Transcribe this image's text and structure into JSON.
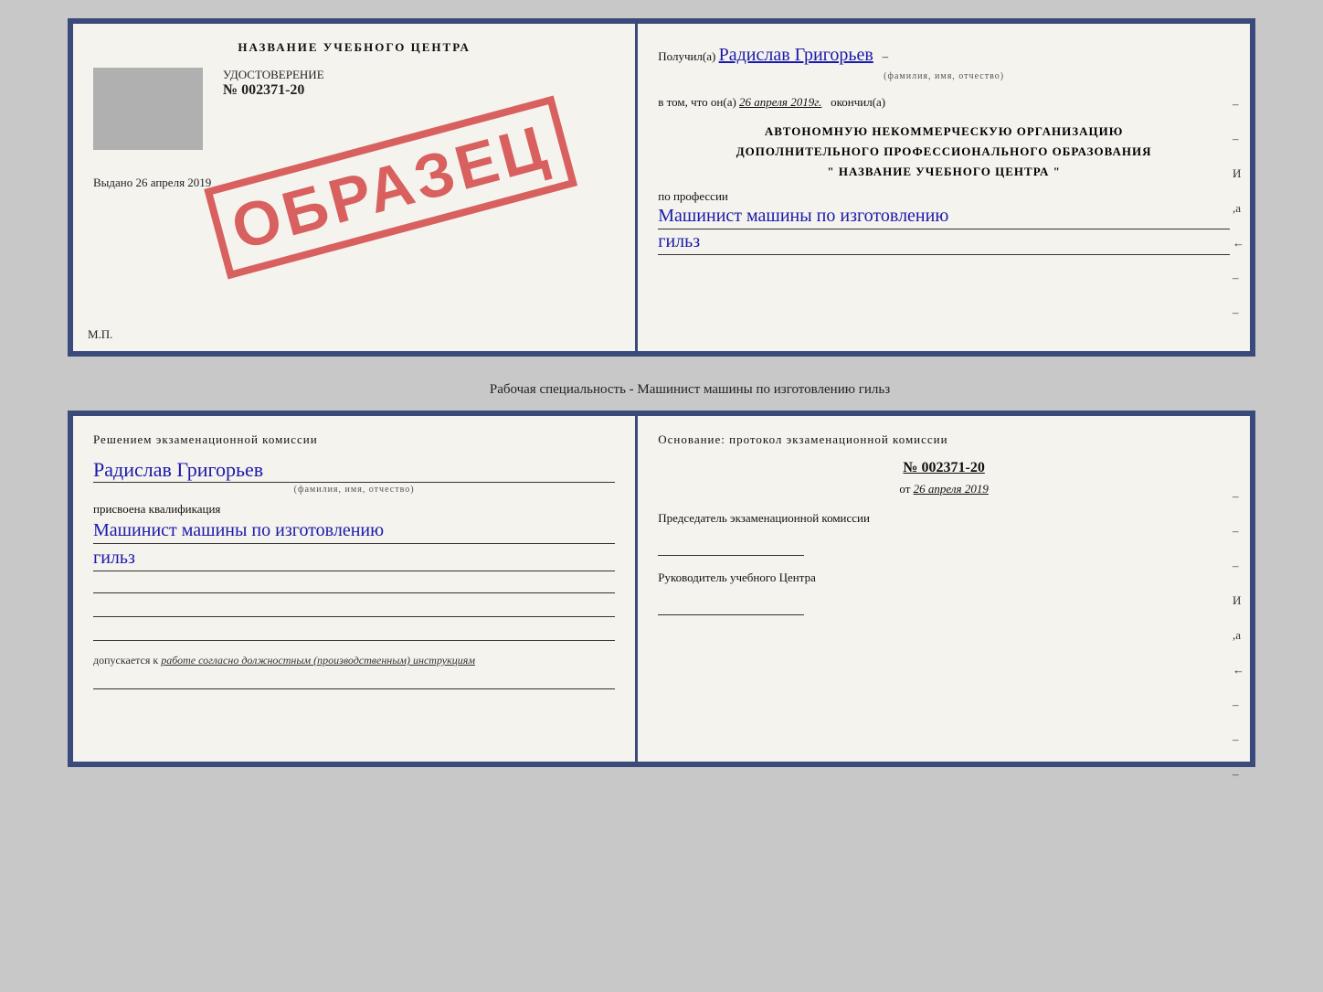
{
  "top_left": {
    "center_title": "НАЗВАНИЕ УЧЕБНОГО ЦЕНТРА",
    "uds_label": "УДОСТОВЕРЕНИЕ",
    "uds_number": "№ 002371-20",
    "vibrano_label": "Выдано",
    "vibrano_date": "26 апреля 2019",
    "mp_label": "М.П.",
    "obrazec": "ОБРАЗЕЦ"
  },
  "top_right": {
    "poluchil_label": "Получил(а)",
    "poluchil_name": "Радислав Григорьев",
    "fio_subtitle": "(фамилия, имя, отчество)",
    "v_tom_chto_label": "в том, что он(а)",
    "date_value": "26 апреля 2019г.",
    "okonchil_label": "окончил(а)",
    "org_line1": "АВТОНОМНУЮ НЕКОММЕРЧЕСКУЮ ОРГАНИЗАЦИЮ",
    "org_line2": "ДОПОЛНИТЕЛЬНОГО ПРОФЕССИОНАЛЬНОГО ОБРАЗОВАНИЯ",
    "org_quote": "\"     НАЗВАНИЕ УЧЕБНОГО ЦЕНТРА     \"",
    "po_professii_label": "по профессии",
    "profession_line1": "Машинист машины по изготовлению",
    "profession_line2": "гильз",
    "dashes": [
      "-",
      "-",
      "И",
      ",а",
      "←",
      "-",
      "-"
    ]
  },
  "caption": "Рабочая специальность - Машинист машины по изготовлению гильз",
  "bottom_left": {
    "title": "Решением  экзаменационной  комиссии",
    "name": "Радислав Григорьев",
    "fio_subtitle": "(фамилия, имя, отчество)",
    "prisvoena_label": "присвоена квалификация",
    "profession_line1": "Машинист  машины  по  изготовлению",
    "profession_line2": "гильз",
    "dopuskaetsya_label": "допускается к",
    "dopuskaetsya_text": "работе согласно должностным (производственным) инструкциям"
  },
  "bottom_right": {
    "title": "Основание: протокол экзаменационной  комиссии",
    "number_label": "№  002371-20",
    "date_label": "от",
    "date_value": "26 апреля 2019",
    "chairman_label": "Председатель экзаменационной комиссии",
    "director_label": "Руководитель учебного Центра",
    "dashes": [
      "-",
      "-",
      "-",
      "И",
      ",а",
      "←",
      "-",
      "-",
      "-"
    ]
  }
}
